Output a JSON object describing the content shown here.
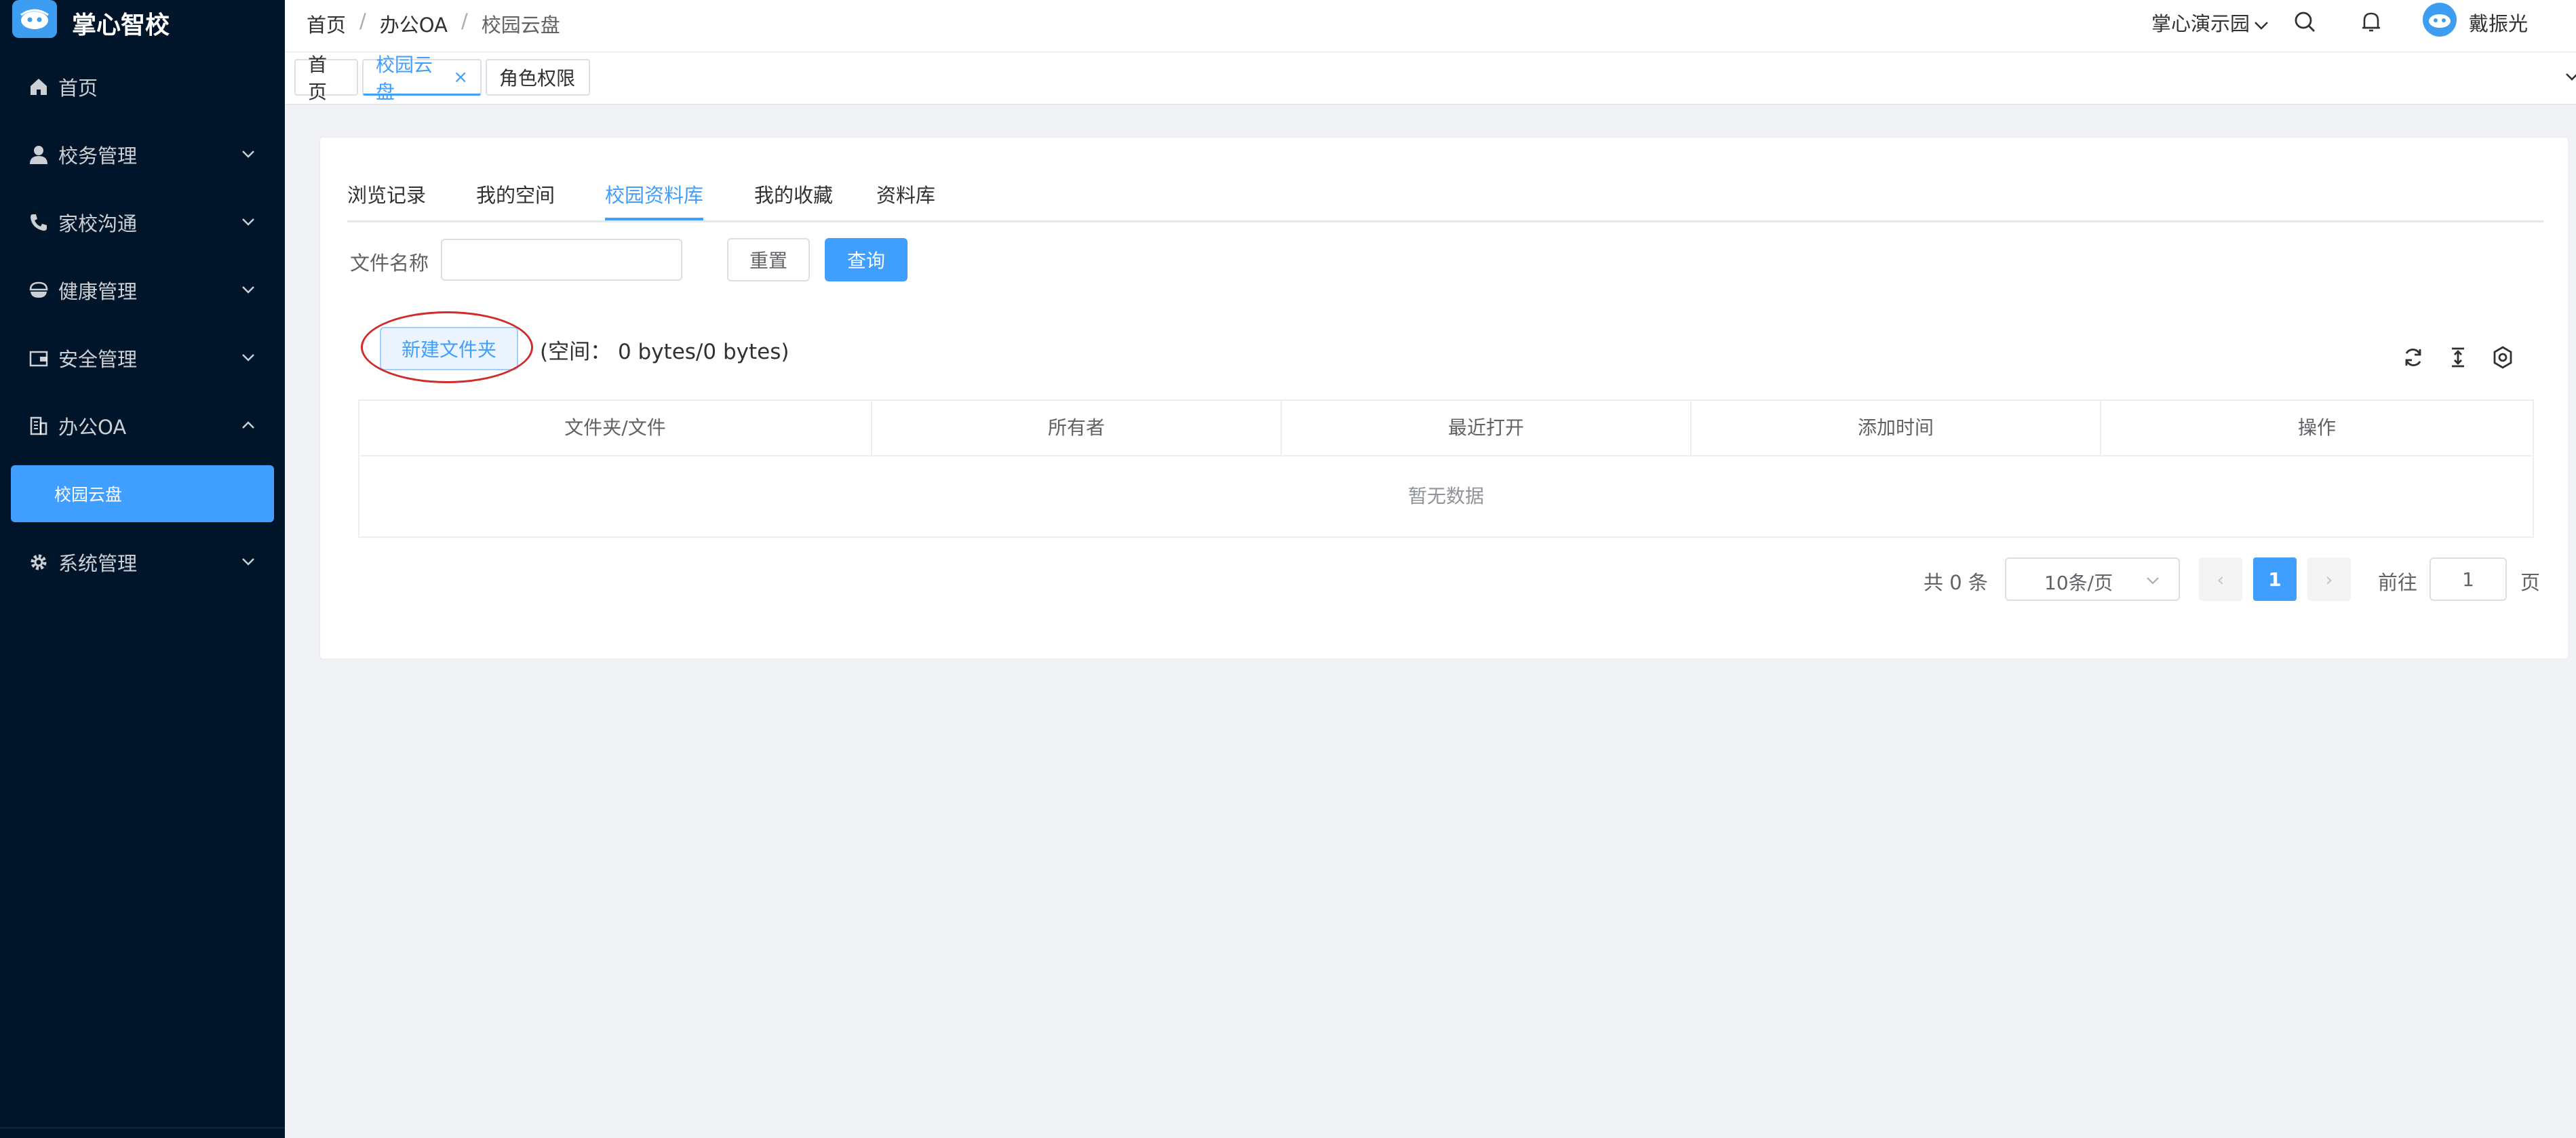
{
  "app": {
    "title": "掌心智校"
  },
  "sidebar": {
    "items": [
      {
        "label": "首页",
        "icon": "home-icon"
      },
      {
        "label": "校务管理",
        "icon": "user-icon"
      },
      {
        "label": "家校沟通",
        "icon": "phone-icon"
      },
      {
        "label": "健康管理",
        "icon": "bowl-icon"
      },
      {
        "label": "安全管理",
        "icon": "wallet-icon"
      },
      {
        "label": "办公OA",
        "icon": "office-building-icon",
        "expanded": true
      },
      {
        "label": "系统管理",
        "icon": "gear-icon"
      }
    ],
    "active_sub_item": "校园云盘"
  },
  "header": {
    "breadcrumb": [
      "首页",
      "办公OA",
      "校园云盘"
    ],
    "breadcrumb_sep": "/",
    "school": "掌心演示园",
    "username": "戴振光"
  },
  "tags": [
    {
      "label": "首页",
      "active": false
    },
    {
      "label": "校园云盘",
      "active": true,
      "close": "×"
    },
    {
      "label": "角色权限",
      "active": false
    }
  ],
  "tabs": [
    "浏览记录",
    "我的空间",
    "校园资料库",
    "我的收藏",
    "资料库"
  ],
  "active_tab": "校园资料库",
  "search": {
    "label": "文件名称",
    "value": "",
    "placeholder": ""
  },
  "buttons": {
    "reset": "重置",
    "query": "查询",
    "new_folder": "新建文件夹"
  },
  "space_info": "(空间： 0 bytes/0 bytes)",
  "table": {
    "columns": [
      "文件夹/文件",
      "所有者",
      "最近打开",
      "添加时间",
      "操作"
    ],
    "empty_text": "暂无数据"
  },
  "pagination": {
    "total": "共 0 条",
    "page_size": "10条/页",
    "prev": "‹",
    "current": "1",
    "next": "›",
    "goto_label": "前往",
    "goto_value": "1",
    "page_suffix": "页"
  },
  "colors": {
    "primary": "#409eff",
    "sidebar_bg": "#001529",
    "annotation": "#d12c2c"
  }
}
